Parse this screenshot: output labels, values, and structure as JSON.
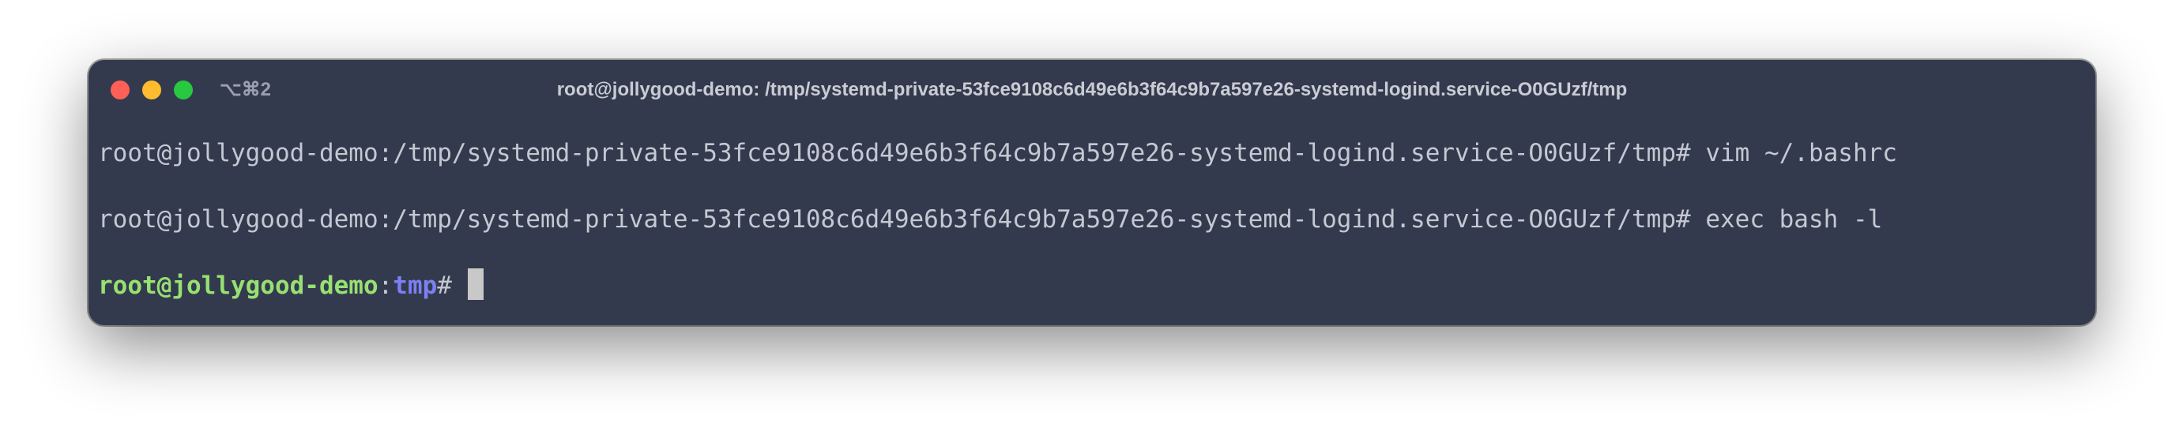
{
  "window": {
    "shortcut": "⌥⌘2",
    "title": "root@jollygood-demo: /tmp/systemd-private-53fce9108c6d49e6b3f64c9b7a597e26-systemd-logind.service-O0GUzf/tmp"
  },
  "terminal": {
    "lines": [
      "root@jollygood-demo:/tmp/systemd-private-53fce9108c6d49e6b3f64c9b7a597e26-systemd-logind.service-O0GUzf/tmp# vim ~/.bashrc",
      "root@jollygood-demo:/tmp/systemd-private-53fce9108c6d49e6b3f64c9b7a597e26-systemd-logind.service-O0GUzf/tmp# exec bash -l"
    ],
    "prompt": {
      "user_host": "root@jollygood-demo",
      "separator": ":",
      "dir": "tmp",
      "symbol": "#"
    }
  },
  "colors": {
    "background": "#343a4d",
    "text": "#c4c8d2",
    "prompt_user": "#97e072",
    "prompt_dir": "#7b80f2",
    "close": "#fe5f57",
    "minimize": "#febc2e",
    "maximize": "#28c840"
  }
}
